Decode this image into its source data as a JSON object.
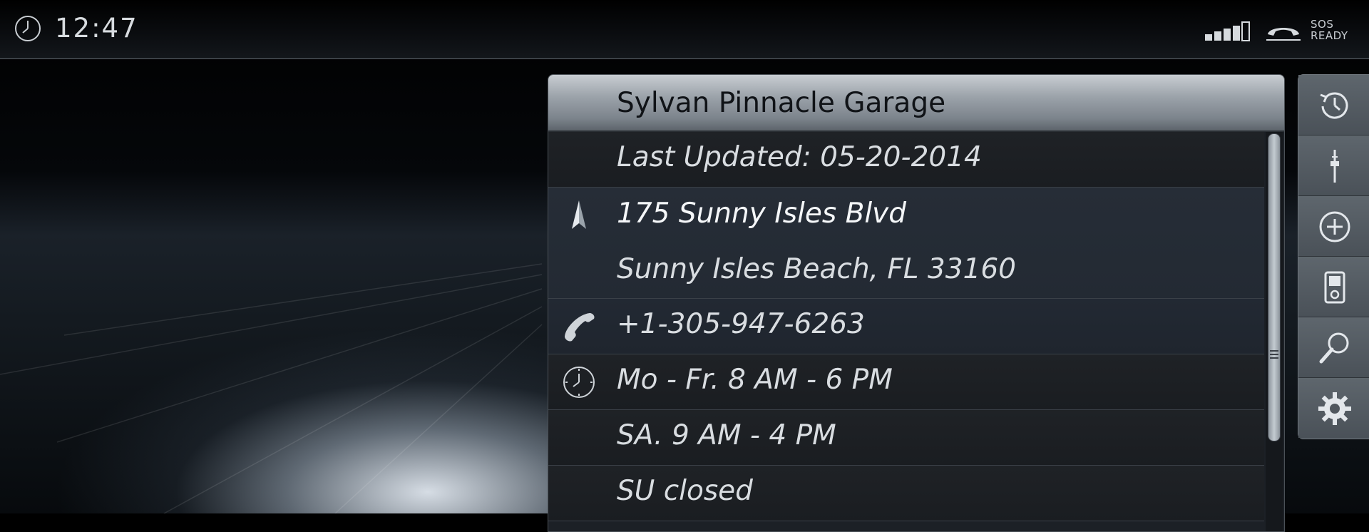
{
  "status_bar": {
    "time": "12:47",
    "sos_line1": "SOS",
    "sos_line2": "READY",
    "icons": [
      "clock-icon",
      "signal-strength-icon",
      "phone-handset-icon"
    ]
  },
  "poi_detail": {
    "title": "Sylvan Pinnacle Garage",
    "last_updated": "Last Updated: 05-20-2014",
    "address_line1": "175 Sunny Isles Blvd",
    "address_line2": "Sunny Isles Beach, FL 33160",
    "phone": "+1-305-947-6263",
    "hours_weekdays": "Mo - Fr. 8 AM - 6 PM",
    "hours_saturday": "SA. 9 AM - 4 PM",
    "hours_sunday": "SU closed",
    "icons": [
      "navigation-arrow-icon",
      "phone-icon",
      "clock-icon"
    ]
  },
  "side_menu": {
    "items": [
      "history-icon",
      "tower-icon",
      "add-icon",
      "device-icon",
      "search-icon",
      "settings-icon"
    ]
  },
  "colors": {
    "header_top": "#c8cdd2",
    "header_bottom": "#5d646b",
    "panel_bg": "#1c2026",
    "highlight_row": "#262d37",
    "text": "#d9dde1"
  }
}
